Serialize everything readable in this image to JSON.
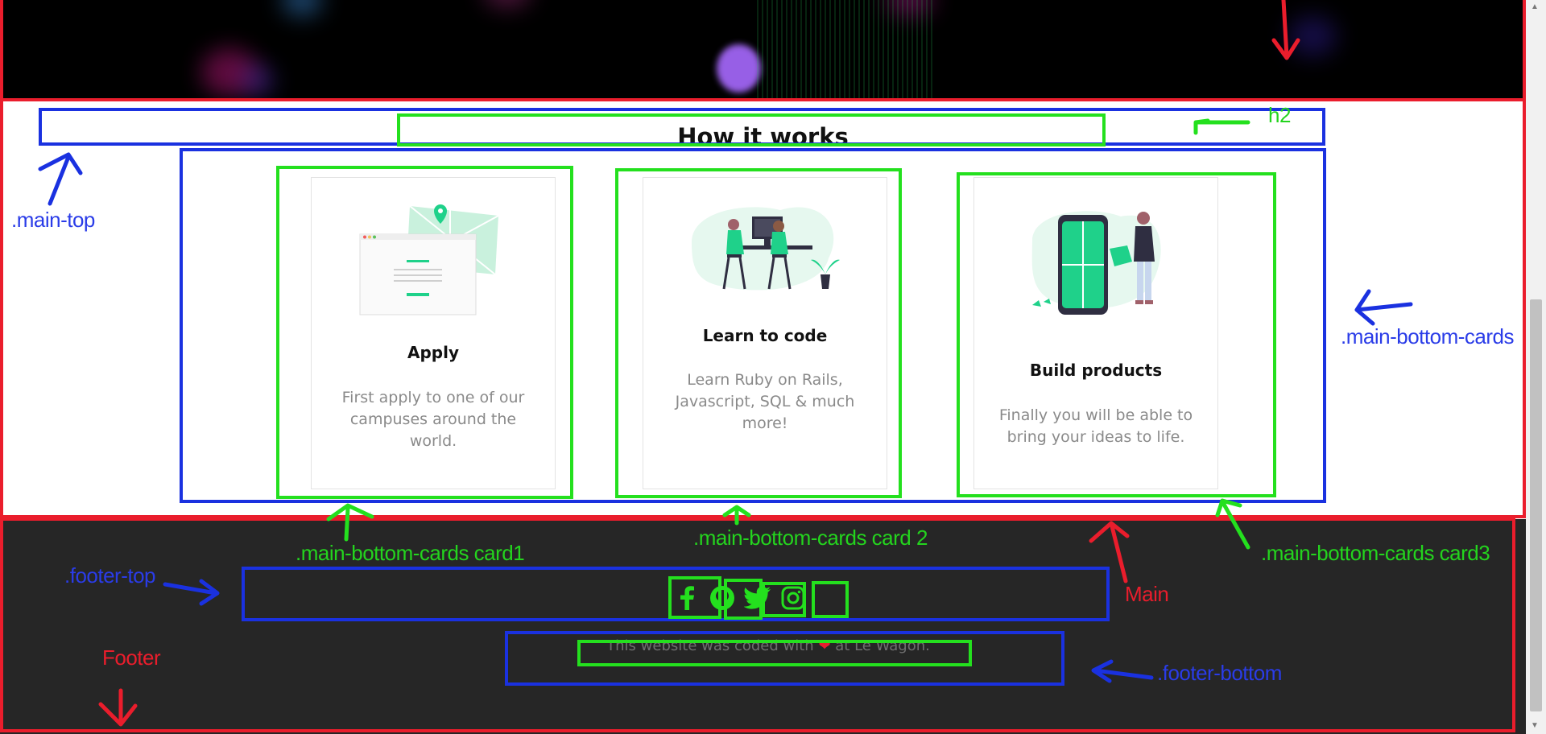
{
  "main": {
    "title": "How it works",
    "cards": [
      {
        "title": "Apply",
        "text": "First apply to one of our campuses around the world."
      },
      {
        "title": "Learn to code",
        "text": "Learn Ruby on Rails, Javascript, SQL & much more!"
      },
      {
        "title": "Build products",
        "text": "Finally you will be able to bring your ideas to life."
      }
    ]
  },
  "footer": {
    "social": [
      "facebook-icon",
      "github-icon",
      "twitter-icon",
      "instagram-icon"
    ],
    "text_before": "This website was coded with",
    "text_after": "at Le Wagon."
  },
  "annotations": {
    "main_top": ".main-top",
    "h2": "h2",
    "main_bottom_cards": ".main-bottom-cards",
    "card1": ".main-bottom-cards card1",
    "card2": ".main-bottom-cards card 2",
    "card3": ".main-bottom-cards card3",
    "main": "Main",
    "footer_top": ".footer-top",
    "footer": "Footer",
    "footer_bottom": ".footer-bottom"
  },
  "colors": {
    "accent_green": "#1fd18a",
    "annotation_red": "#ea1d2c",
    "annotation_blue": "#1a31e0",
    "annotation_green": "#24e01e",
    "footer_bg": "#262626",
    "heart": "#e81c2e"
  }
}
